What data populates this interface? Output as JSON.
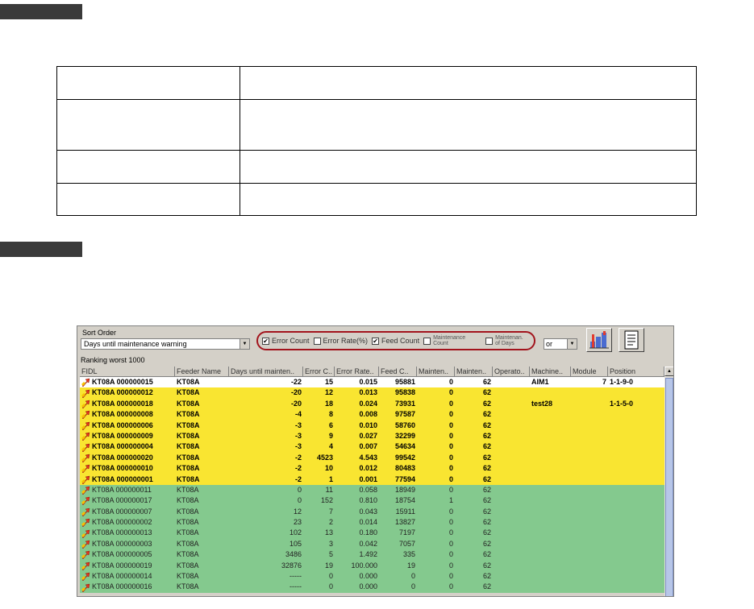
{
  "panel": {
    "sort_label": "Sort Order",
    "sort_value": "Days until maintenance warning",
    "filters": [
      {
        "label": "Error Count",
        "checked": true
      },
      {
        "label": "Error Rate(%)",
        "checked": false
      },
      {
        "label": "Feed Count",
        "checked": true
      },
      {
        "label": "Maintenance Count",
        "checked": false
      },
      {
        "label": "Maintenan. of Days",
        "checked": false
      }
    ],
    "logic_value": "or",
    "ranking_label": "Ranking worst 1000",
    "check_mark": "✔",
    "dropdown_arrow": "▼",
    "scroll_up_arrow": "▲"
  },
  "table": {
    "columns": [
      "FIDL",
      "Feeder Name",
      "Days until mainten..",
      "Error C..",
      "Error Rate..",
      "Feed C..",
      "Mainten..",
      "Mainten..",
      "Operato..",
      "Machine..",
      "Module",
      "Position"
    ],
    "rows": [
      {
        "s": "white",
        "c": [
          "KT08A 000000015",
          "KT08A",
          "-22",
          "15",
          "0.015",
          "95881",
          "0",
          "62",
          "",
          "AIM1",
          "7",
          "1-1-9-0"
        ]
      },
      {
        "s": "yellow",
        "c": [
          "KT08A 000000012",
          "KT08A",
          "-20",
          "12",
          "0.013",
          "95838",
          "0",
          "62",
          "",
          "",
          "",
          ""
        ]
      },
      {
        "s": "yellow",
        "c": [
          "KT08A 000000018",
          "KT08A",
          "-20",
          "18",
          "0.024",
          "73931",
          "0",
          "62",
          "",
          "test28",
          "",
          "1-1-5-0"
        ]
      },
      {
        "s": "yellow",
        "c": [
          "KT08A 000000008",
          "KT08A",
          "-4",
          "8",
          "0.008",
          "97587",
          "0",
          "62",
          "",
          "",
          "",
          ""
        ]
      },
      {
        "s": "yellow",
        "c": [
          "KT08A 000000006",
          "KT08A",
          "-3",
          "6",
          "0.010",
          "58760",
          "0",
          "62",
          "",
          "",
          "",
          ""
        ]
      },
      {
        "s": "yellow",
        "c": [
          "KT08A 000000009",
          "KT08A",
          "-3",
          "9",
          "0.027",
          "32299",
          "0",
          "62",
          "",
          "",
          "",
          ""
        ]
      },
      {
        "s": "yellow",
        "c": [
          "KT08A 000000004",
          "KT08A",
          "-3",
          "4",
          "0.007",
          "54634",
          "0",
          "62",
          "",
          "",
          "",
          ""
        ]
      },
      {
        "s": "yellow",
        "c": [
          "KT08A 000000020",
          "KT08A",
          "-2",
          "4523",
          "4.543",
          "99542",
          "0",
          "62",
          "",
          "",
          "",
          ""
        ]
      },
      {
        "s": "yellow",
        "c": [
          "KT08A 000000010",
          "KT08A",
          "-2",
          "10",
          "0.012",
          "80483",
          "0",
          "62",
          "",
          "",
          "",
          ""
        ]
      },
      {
        "s": "yellow",
        "c": [
          "KT08A 000000001",
          "KT08A",
          "-2",
          "1",
          "0.001",
          "77594",
          "0",
          "62",
          "",
          "",
          "",
          ""
        ]
      },
      {
        "s": "green",
        "c": [
          "KT08A 000000011",
          "KT08A",
          "0",
          "11",
          "0.058",
          "18949",
          "0",
          "62",
          "",
          "",
          "",
          ""
        ]
      },
      {
        "s": "green",
        "c": [
          "KT08A 000000017",
          "KT08A",
          "0",
          "152",
          "0.810",
          "18754",
          "1",
          "62",
          "",
          "",
          "",
          ""
        ]
      },
      {
        "s": "green",
        "c": [
          "KT08A 000000007",
          "KT08A",
          "12",
          "7",
          "0.043",
          "15911",
          "0",
          "62",
          "",
          "",
          "",
          ""
        ]
      },
      {
        "s": "green",
        "c": [
          "KT08A 000000002",
          "KT08A",
          "23",
          "2",
          "0.014",
          "13827",
          "0",
          "62",
          "",
          "",
          "",
          ""
        ]
      },
      {
        "s": "green",
        "c": [
          "KT08A 000000013",
          "KT08A",
          "102",
          "13",
          "0.180",
          "7197",
          "0",
          "62",
          "",
          "",
          "",
          ""
        ]
      },
      {
        "s": "green",
        "c": [
          "KT08A 000000003",
          "KT08A",
          "105",
          "3",
          "0.042",
          "7057",
          "0",
          "62",
          "",
          "",
          "",
          ""
        ]
      },
      {
        "s": "green",
        "c": [
          "KT08A 000000005",
          "KT08A",
          "3486",
          "5",
          "1.492",
          "335",
          "0",
          "62",
          "",
          "",
          "",
          ""
        ]
      },
      {
        "s": "green",
        "c": [
          "KT08A 000000019",
          "KT08A",
          "32876",
          "19",
          "100.000",
          "19",
          "0",
          "62",
          "",
          "",
          "",
          ""
        ]
      },
      {
        "s": "green",
        "c": [
          "KT08A 000000014",
          "KT08A",
          "-----",
          "0",
          "0.000",
          "0",
          "0",
          "62",
          "",
          "",
          "",
          ""
        ]
      },
      {
        "s": "green",
        "c": [
          "KT08A 000000016",
          "KT08A",
          "-----",
          "0",
          "0.000",
          "0",
          "0",
          "62",
          "",
          "",
          "",
          ""
        ]
      }
    ],
    "right_align_columns": [
      2,
      3,
      4,
      5,
      6,
      7,
      10
    ]
  },
  "colors": {
    "highlight_red": "#a2131c",
    "row_white": "#ffffff",
    "row_yellow": "#f9e531",
    "row_green": "#84c98e"
  },
  "icons": {
    "row_icon": "feeder-arrow-icon",
    "tool_1": "chart-tool-icon",
    "tool_2": "report-icon"
  }
}
